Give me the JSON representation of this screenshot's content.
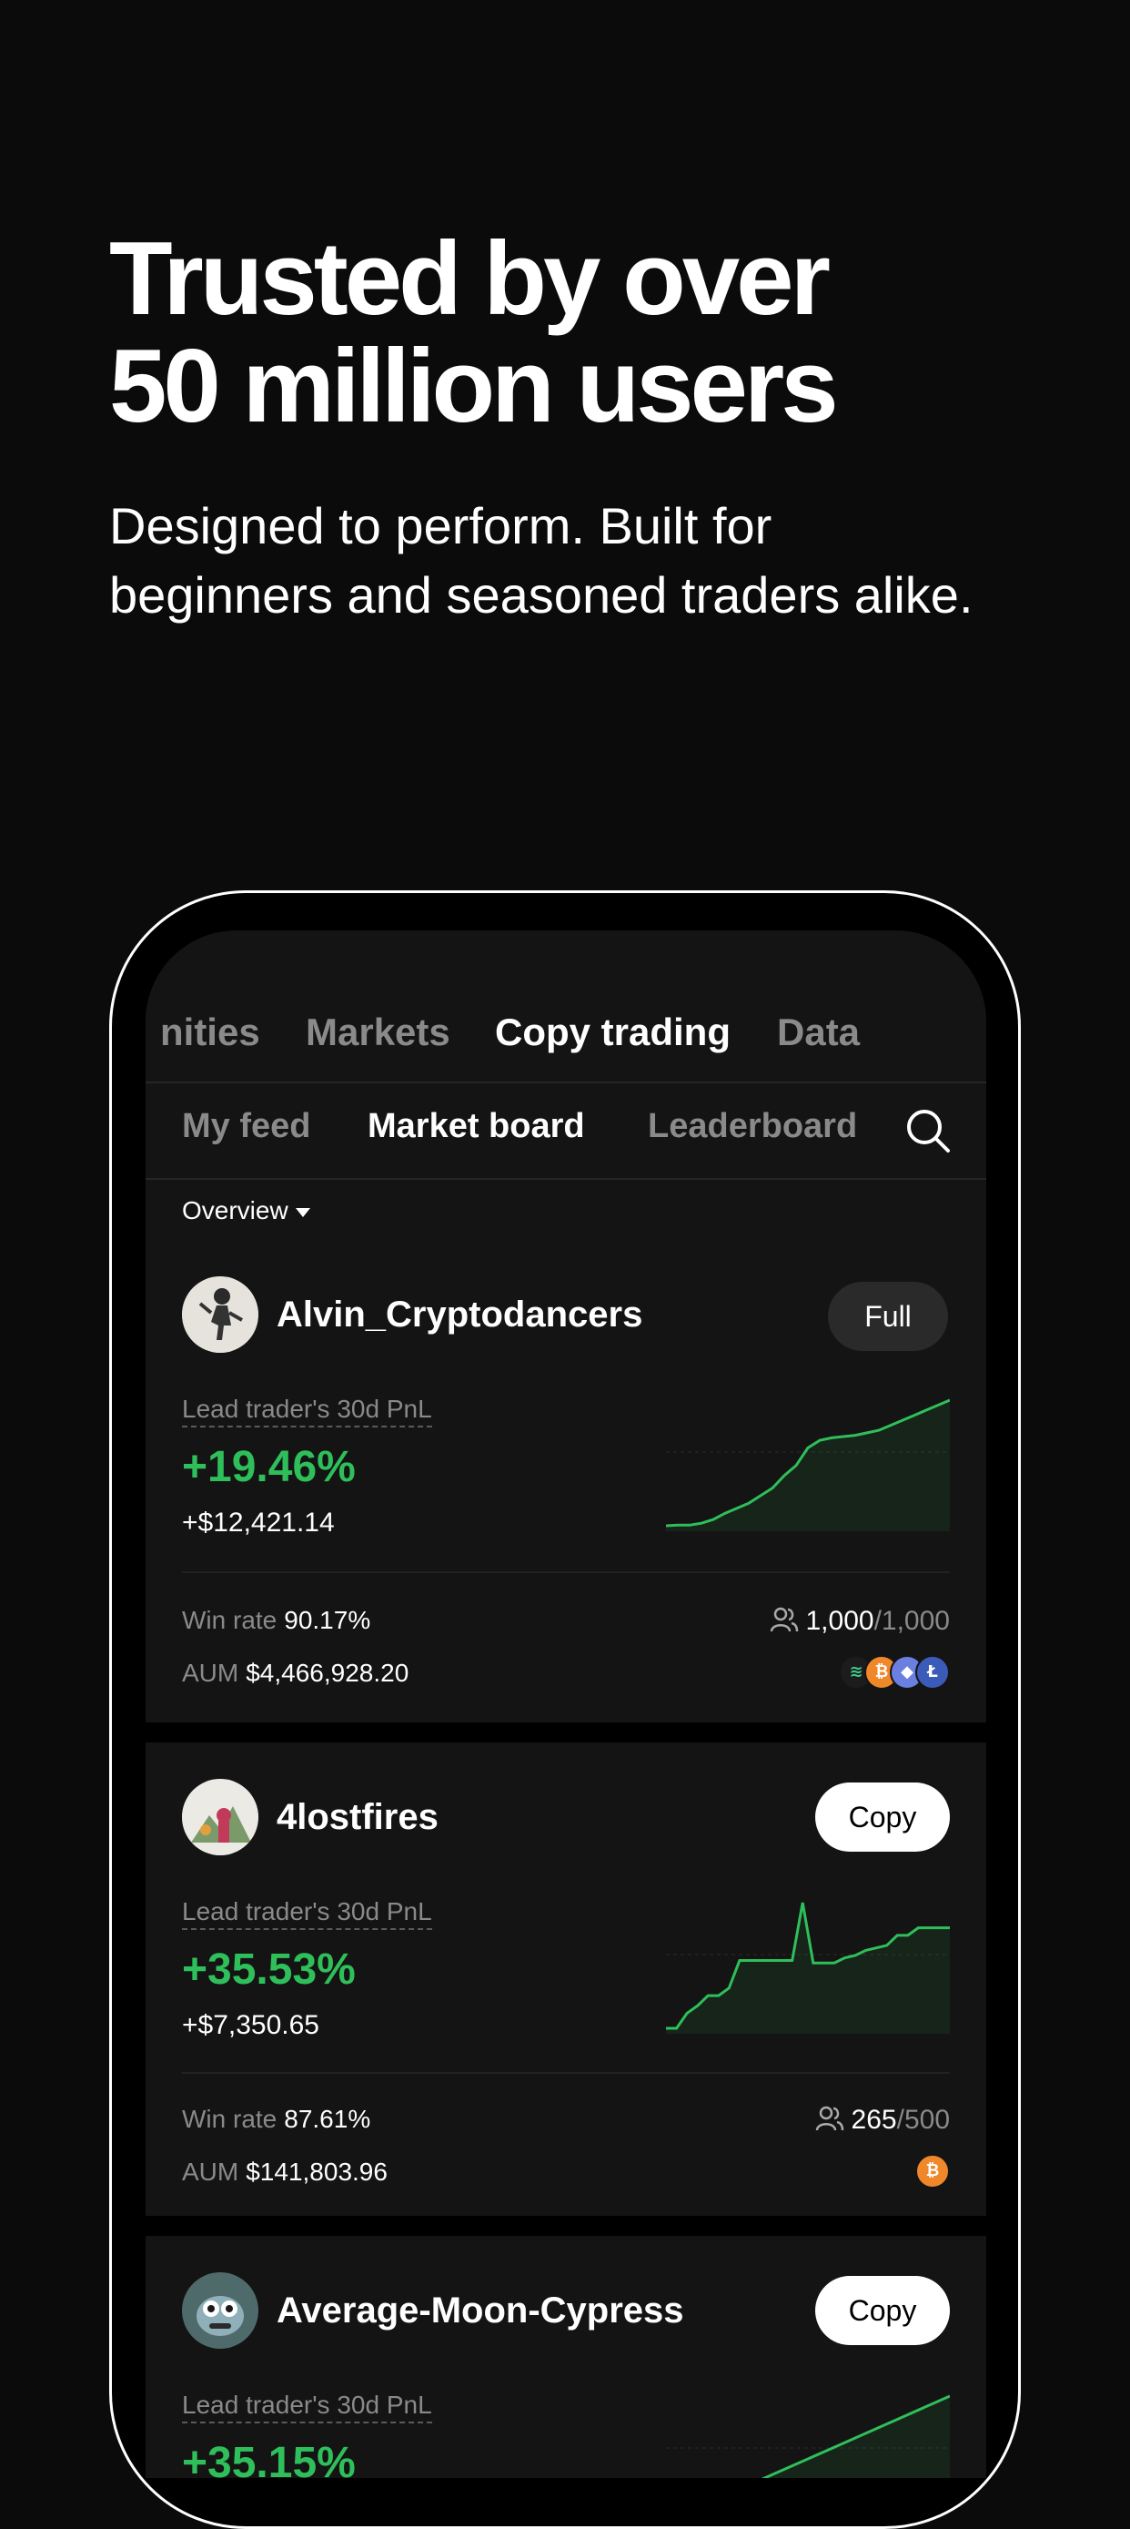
{
  "hero": {
    "title_line1": "Trusted by over",
    "title_line2": "50 million users",
    "subtitle_line1": "Designed to perform. Built for",
    "subtitle_line2": "beginners and seasoned traders alike."
  },
  "top_tabs": [
    {
      "label": "nities",
      "active": false
    },
    {
      "label": "Markets",
      "active": false
    },
    {
      "label": "Copy trading",
      "active": true
    },
    {
      "label": "Data",
      "active": false
    }
  ],
  "sub_tabs": [
    {
      "label": "My feed",
      "active": false
    },
    {
      "label": "Market board",
      "active": true
    },
    {
      "label": "Leaderboard",
      "active": false
    }
  ],
  "search_icon": "search-icon",
  "overview": {
    "label": "Overview"
  },
  "pnl_label": "Lead trader's 30d PnL",
  "win_rate_label": "Win rate",
  "aum_label": "AUM",
  "accent_color": "#2fbf5a",
  "traders": [
    {
      "name": "Alvin_Cryptodancers",
      "button": "Full",
      "pnl_pct": "+19.46%",
      "pnl_amount": "+$12,421.14",
      "win_rate": "90.17%",
      "aum": "$4,466,928.20",
      "copiers": "1,000",
      "copiers_max": "/1,000",
      "coins": [
        "stacks",
        "btc",
        "eth",
        "ltc"
      ],
      "sparkline": [
        0,
        0.5,
        0.5,
        2,
        5,
        10,
        14,
        18,
        24,
        30,
        40,
        48,
        62,
        68,
        70,
        71,
        72,
        74,
        76,
        80,
        84,
        88,
        92,
        96,
        100
      ]
    },
    {
      "name": "4lostfires",
      "button": "Copy",
      "pnl_pct": "+35.53%",
      "pnl_amount": "+$7,350.65",
      "win_rate": "87.61%",
      "aum": "$141,803.96",
      "copiers": "265",
      "copiers_max": "/500",
      "coins": [
        "btc"
      ],
      "sparkline": [
        0,
        0,
        12,
        18,
        26,
        26,
        32,
        54,
        54,
        54,
        54,
        54,
        54,
        100,
        52,
        52,
        52,
        56,
        58,
        62,
        64,
        66,
        74,
        74,
        80,
        80,
        80,
        80
      ]
    },
    {
      "name": "Average-Moon-Cypress",
      "button": "Copy",
      "pnl_pct": "+35.15%",
      "pnl_amount": "",
      "sparkline": [
        0,
        20,
        40,
        60,
        80,
        100
      ]
    }
  ]
}
